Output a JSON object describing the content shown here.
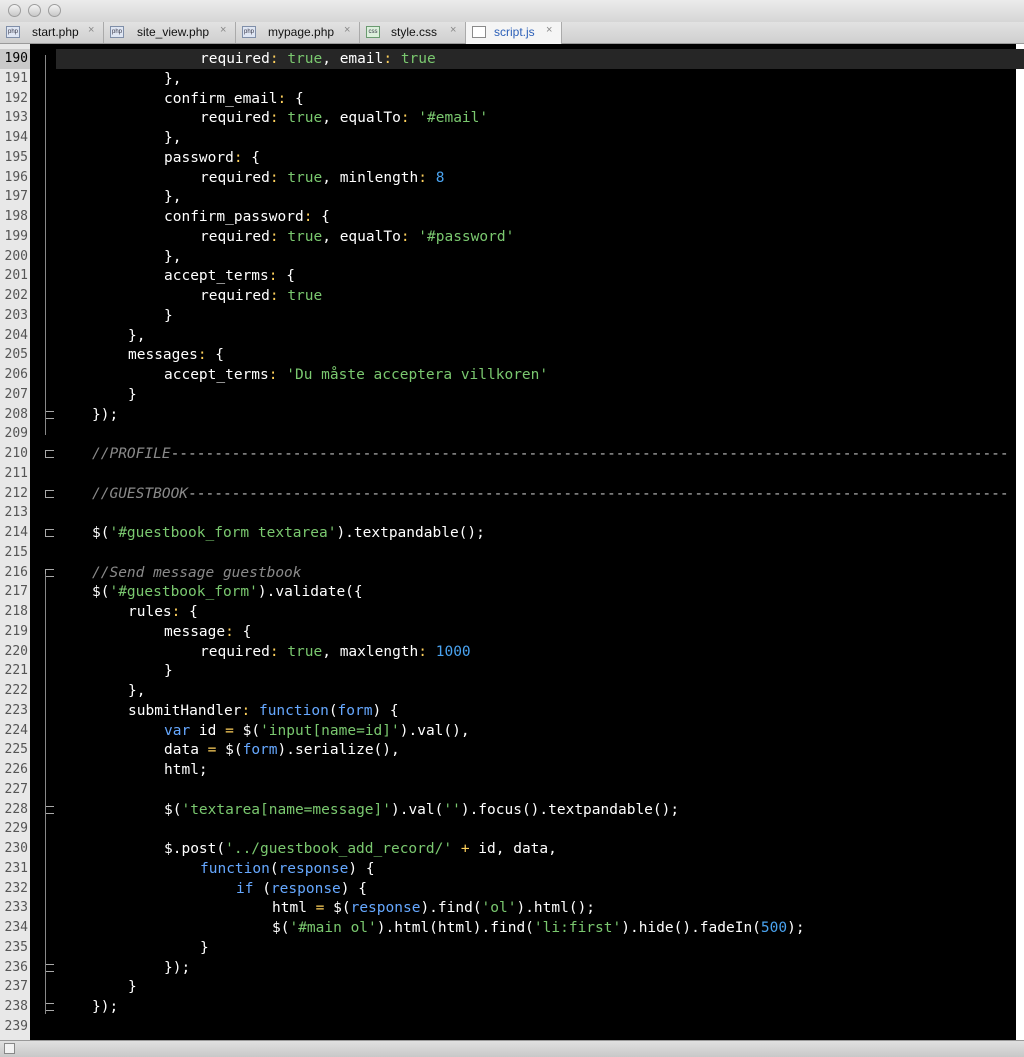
{
  "tabs": [
    {
      "label": "start.php",
      "icon": "php-file-icon"
    },
    {
      "label": "site_view.php",
      "icon": "php-file-icon"
    },
    {
      "label": "mypage.php",
      "icon": "php-file-icon"
    },
    {
      "label": "style.css",
      "icon": "css-file-icon"
    },
    {
      "label": "script.js",
      "icon": "js-file-icon",
      "active": true
    }
  ],
  "editor": {
    "current_line": "190",
    "lines": [
      {
        "n": "190",
        "text": "required: true, email: true"
      },
      {
        "n": "191",
        "text": "},"
      },
      {
        "n": "192",
        "text": "confirm_email: {"
      },
      {
        "n": "193",
        "text": "required: true, equalTo: '#email'"
      },
      {
        "n": "194",
        "text": "},"
      },
      {
        "n": "195",
        "text": "password: {"
      },
      {
        "n": "196",
        "text": "required: true, minlength: 8"
      },
      {
        "n": "197",
        "text": "},"
      },
      {
        "n": "198",
        "text": "confirm_password: {"
      },
      {
        "n": "199",
        "text": "required: true, equalTo: '#password'"
      },
      {
        "n": "200",
        "text": "},"
      },
      {
        "n": "201",
        "text": "accept_terms: {"
      },
      {
        "n": "202",
        "text": "required: true"
      },
      {
        "n": "203",
        "text": "}"
      },
      {
        "n": "204",
        "text": "},"
      },
      {
        "n": "205",
        "text": "messages: {"
      },
      {
        "n": "206",
        "text": "accept_terms: 'Du måste acceptera villkoren'"
      },
      {
        "n": "207",
        "text": "}"
      },
      {
        "n": "208",
        "text": "});"
      },
      {
        "n": "209",
        "text": ""
      },
      {
        "n": "210",
        "text": "//PROFILE------------------------------------------------------------------------------------------------"
      },
      {
        "n": "211",
        "text": ""
      },
      {
        "n": "212",
        "text": "//GUESTBOOK----------------------------------------------------------------------------------------------"
      },
      {
        "n": "213",
        "text": ""
      },
      {
        "n": "214",
        "text": "$('#guestbook_form textarea').textpandable();"
      },
      {
        "n": "215",
        "text": ""
      },
      {
        "n": "216",
        "text": "//Send message guestbook"
      },
      {
        "n": "217",
        "text": "$('#guestbook_form').validate({"
      },
      {
        "n": "218",
        "text": "rules: {"
      },
      {
        "n": "219",
        "text": "message: {"
      },
      {
        "n": "220",
        "text": "required: true, maxlength: 1000"
      },
      {
        "n": "221",
        "text": "}"
      },
      {
        "n": "222",
        "text": "},"
      },
      {
        "n": "223",
        "text": "submitHandler: function(form) {"
      },
      {
        "n": "224",
        "text": "var id = $('input[name=id]').val(),"
      },
      {
        "n": "225",
        "text": "data = $(form).serialize(),"
      },
      {
        "n": "226",
        "text": "html;"
      },
      {
        "n": "227",
        "text": ""
      },
      {
        "n": "228",
        "text": "$('textarea[name=message]').val('').focus().textpandable();"
      },
      {
        "n": "229",
        "text": ""
      },
      {
        "n": "230",
        "text": "$.post('../guestbook_add_record/' + id, data,"
      },
      {
        "n": "231",
        "text": "function(response) {"
      },
      {
        "n": "232",
        "text": "if (response) {"
      },
      {
        "n": "233",
        "text": "html = $(response).find('ol').html();"
      },
      {
        "n": "234",
        "text": "$('#main ol').html(html).find('li:first').hide().fadeIn(500);"
      },
      {
        "n": "235",
        "text": "}"
      },
      {
        "n": "236",
        "text": "});"
      },
      {
        "n": "237",
        "text": "}"
      },
      {
        "n": "238",
        "text": "});"
      },
      {
        "n": "239",
        "text": ""
      }
    ]
  },
  "colors": {
    "background": "#000000",
    "keyword": "#66a8ff",
    "string": "#7ac86f",
    "number": "#4aa3f0",
    "comment": "#8a8a8a"
  }
}
